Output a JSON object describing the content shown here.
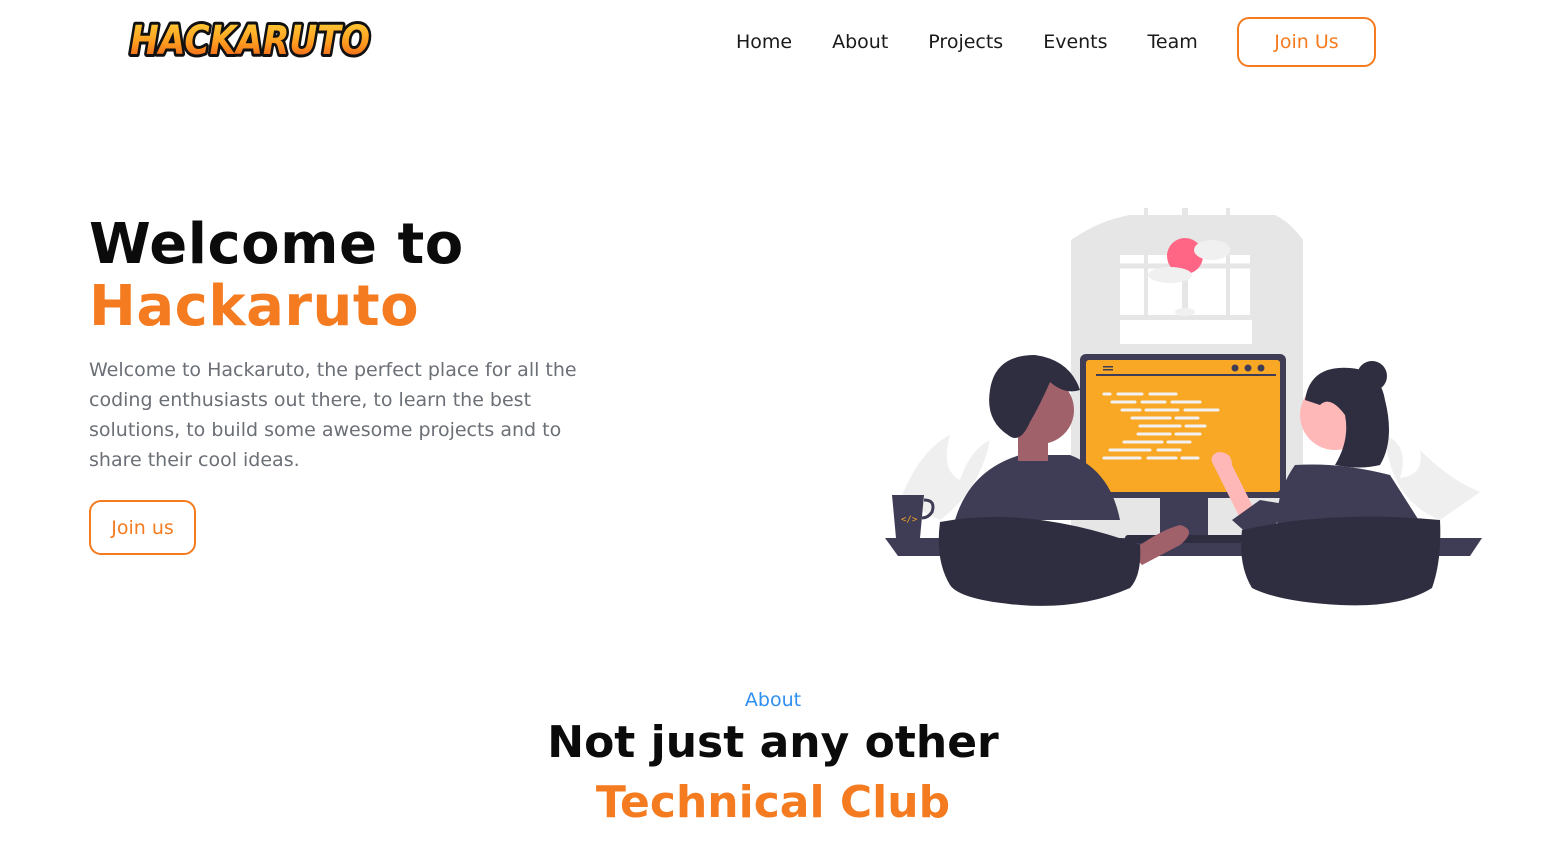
{
  "brand": {
    "logo_text": "HACKARUTO",
    "accent": "#f47b20",
    "link_blue": "#2f8ff0"
  },
  "nav": {
    "items": [
      {
        "label": "Home"
      },
      {
        "label": "About"
      },
      {
        "label": "Projects"
      },
      {
        "label": "Events"
      },
      {
        "label": "Team"
      }
    ],
    "join_label": "Join Us"
  },
  "hero": {
    "title_line1": "Welcome to",
    "title_line2": "Hackaruto",
    "description": "Welcome to Hackaruto, the perfect place for all the coding enthusiasts out there, to learn the best solutions, to build some awesome projects and to share their cool ideas.",
    "cta_label": "Join us",
    "illustration_icon": "two-people-coding-illustration"
  },
  "about": {
    "tag": "About",
    "heading_line1": "Not just any other",
    "heading_line2": "Technical Club"
  }
}
